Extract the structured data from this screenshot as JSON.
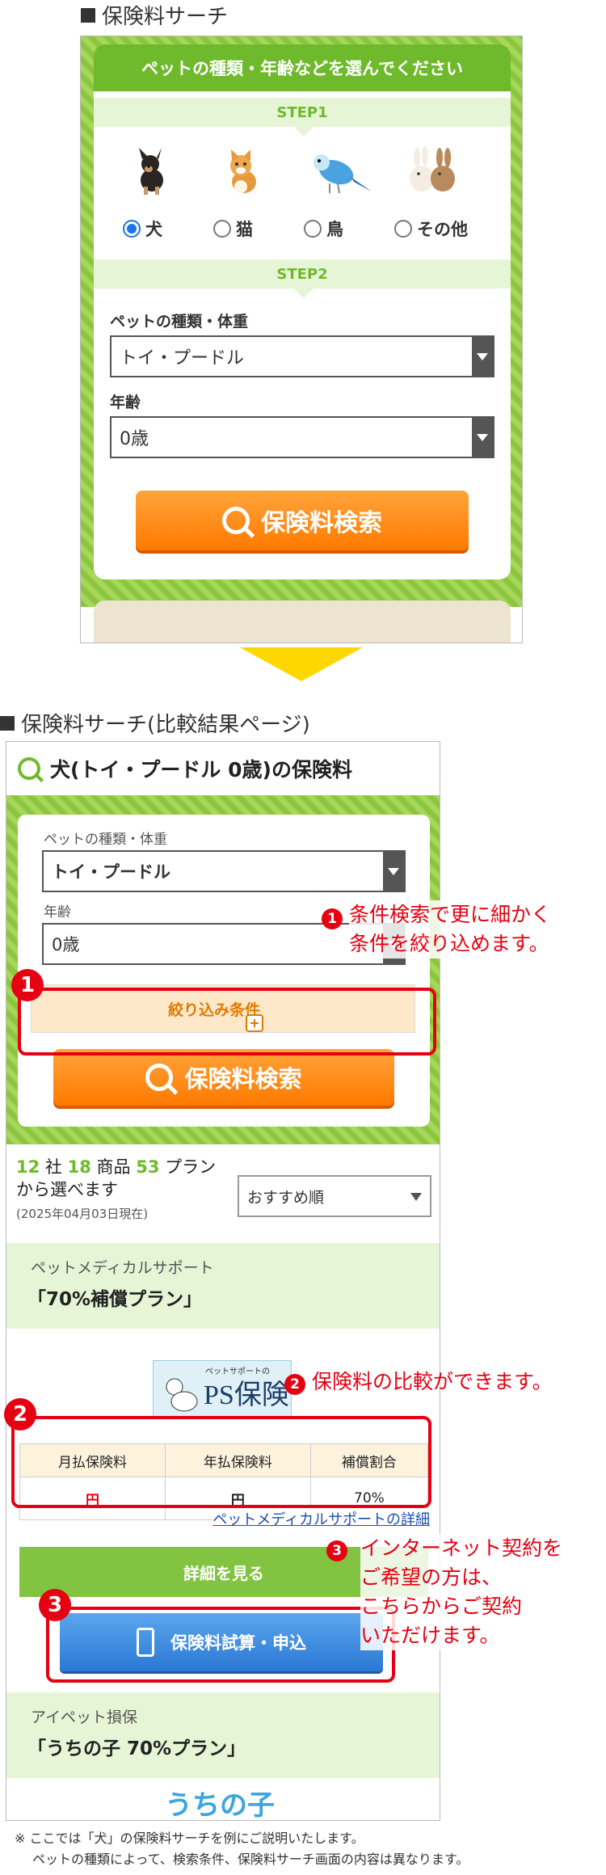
{
  "section1": {
    "title": "保険料サーチ"
  },
  "search_form": {
    "header": "ペットの種類・年齢などを選んでください",
    "step1": "STEP1",
    "step2": "STEP2",
    "pets": [
      {
        "label": "犬",
        "selected": true,
        "icon": "dog-icon"
      },
      {
        "label": "猫",
        "selected": false,
        "icon": "cat-icon"
      },
      {
        "label": "鳥",
        "selected": false,
        "icon": "bird-icon"
      },
      {
        "label": "その他",
        "selected": false,
        "icon": "rabbit-icon"
      }
    ],
    "type_label": "ペットの種類・体重",
    "type_value": "トイ・プードル",
    "age_label": "年齢",
    "age_value": "0歳",
    "search_button": "保険料検索"
  },
  "section2": {
    "title": "保険料サーチ(比較結果ページ)"
  },
  "results": {
    "title": "犬(トイ・プードル 0歳)の保険料",
    "type_label": "ペットの種類・体重",
    "type_value": "トイ・プードル",
    "age_label": "年齢",
    "age_value": "0歳",
    "filter_label": "絞り込み条件",
    "search_button": "保険料検索",
    "summary": {
      "companies": "12",
      "companies_unit": "社",
      "products": "18",
      "products_unit": "商品",
      "plans": "53",
      "plans_unit": "プラン",
      "suffix": "から選べます",
      "date": "(2025年04月03日現在)"
    },
    "sort_value": "おすすめ順",
    "plan1": {
      "company": "ペットメディカルサポート",
      "name": "「70%補償プラン」",
      "logo_small": "ペットサポートの",
      "logo_main": "PS保険",
      "table_headers": [
        "月払保険料",
        "年払保険料",
        "補償割合"
      ],
      "monthly": "円",
      "yearly": "円",
      "ratio": "70%",
      "detail_link": "ペットメディカルサポートの詳細",
      "detail_button": "詳細を見る",
      "apply_button": "保険料試算・申込"
    },
    "plan2": {
      "company": "アイペット損保",
      "name": "「うちの子 70%プラン」",
      "logo": "うちの子"
    }
  },
  "annotations": {
    "n1": "1",
    "n2": "2",
    "n3": "3",
    "note1_line1": "条件検索で更に細かく",
    "note1_line2": "条件を絞り込めます。",
    "note2": "保険料の比較ができます。",
    "note3_line1": "インターネット契約を",
    "note3_line2": "ご希望の方は、",
    "note3_line3": "こちらからご契約",
    "note3_line4": "いただけます。"
  },
  "footnote": {
    "line1": "※ ここでは「犬」の保険料サーチを例にご説明いたします。",
    "line2": "ペットの種類によって、検索条件、保険料サーチ画面の内容は異なります。"
  },
  "colors": {
    "green": "#6fb92c",
    "orange": "#ff8c1a",
    "red": "#e60012",
    "blue": "#2a78d4",
    "arrow": "#ffd700"
  }
}
